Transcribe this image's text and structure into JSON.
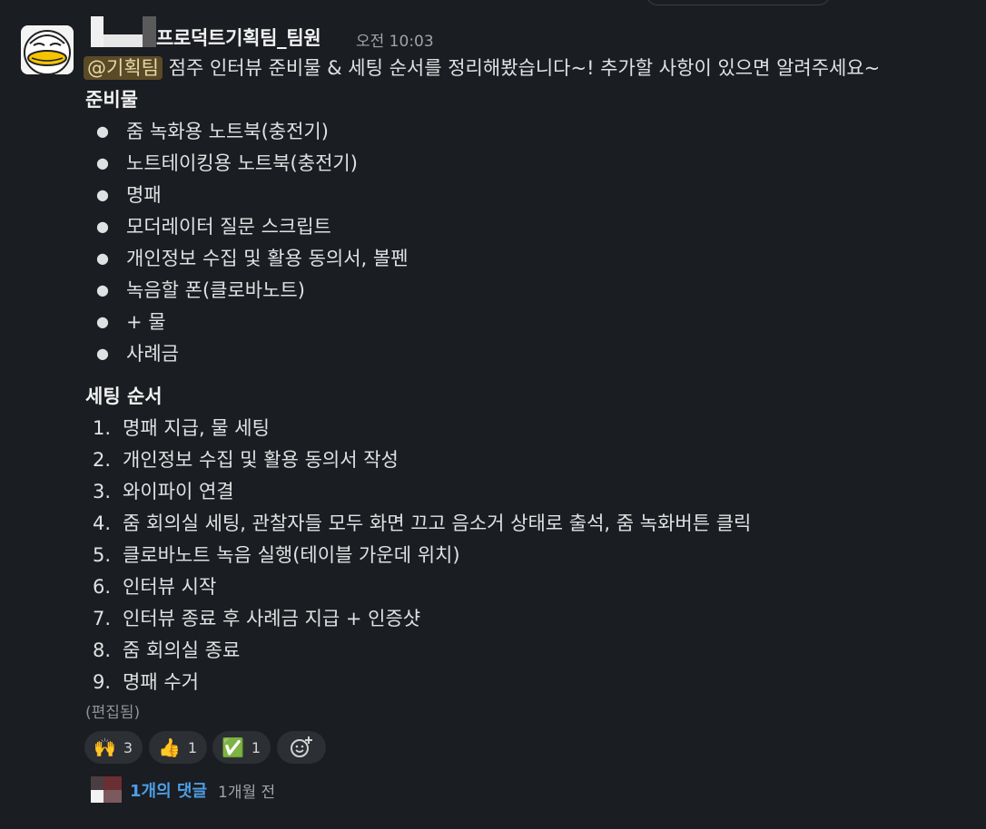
{
  "message": {
    "sender": "프로덕트기획팀_팀원",
    "time": "오전 10:03",
    "mention": "@기획팀",
    "text": "점주 인터뷰 준비물 & 세팅 순서를 정리해봤습니다~! 추가할 사항이 있으면 알려주세요~",
    "edited": "(편집됨)"
  },
  "prep": {
    "title": "준비물",
    "items": [
      "줌 녹화용 노트북(충전기)",
      "노트테이킹용 노트북(충전기)",
      "명패",
      "모더레이터 질문 스크립트",
      "개인정보 수집 및 활용 동의서, 볼펜",
      "녹음할 폰(클로바노트)",
      "+ 물",
      "사례금"
    ]
  },
  "setup": {
    "title": "세팅 순서",
    "numbers": [
      "1.",
      "2.",
      "3.",
      "4.",
      "5.",
      "6.",
      "7.",
      "8.",
      "9."
    ],
    "items": [
      "명패 지급, 물 세팅",
      "개인정보 수집 및 활용 동의서 작성",
      "와이파이 연결",
      "줌 회의실 세팅, 관찰자들 모두 화면 끄고 음소거 상태로 출석, 줌 녹화버튼 클릭",
      "클로바노트 녹음 실행(테이블 가운데 위치)",
      "인터뷰 시작",
      "인터뷰 종료 후 사례금 지급 + 인증샷",
      "줌 회의실 종료",
      "명패 수거"
    ]
  },
  "reactions": [
    {
      "emoji": "🙌",
      "count": "3"
    },
    {
      "emoji": "👍",
      "count": "1"
    },
    {
      "emoji": "✅",
      "count": "1"
    }
  ],
  "thread": {
    "replies": "1개의 댓글",
    "time": "1개월 전"
  },
  "colors": {
    "background": "#1a1d21",
    "mention_bg": "#5a4a27",
    "link": "#4d9ee6"
  }
}
